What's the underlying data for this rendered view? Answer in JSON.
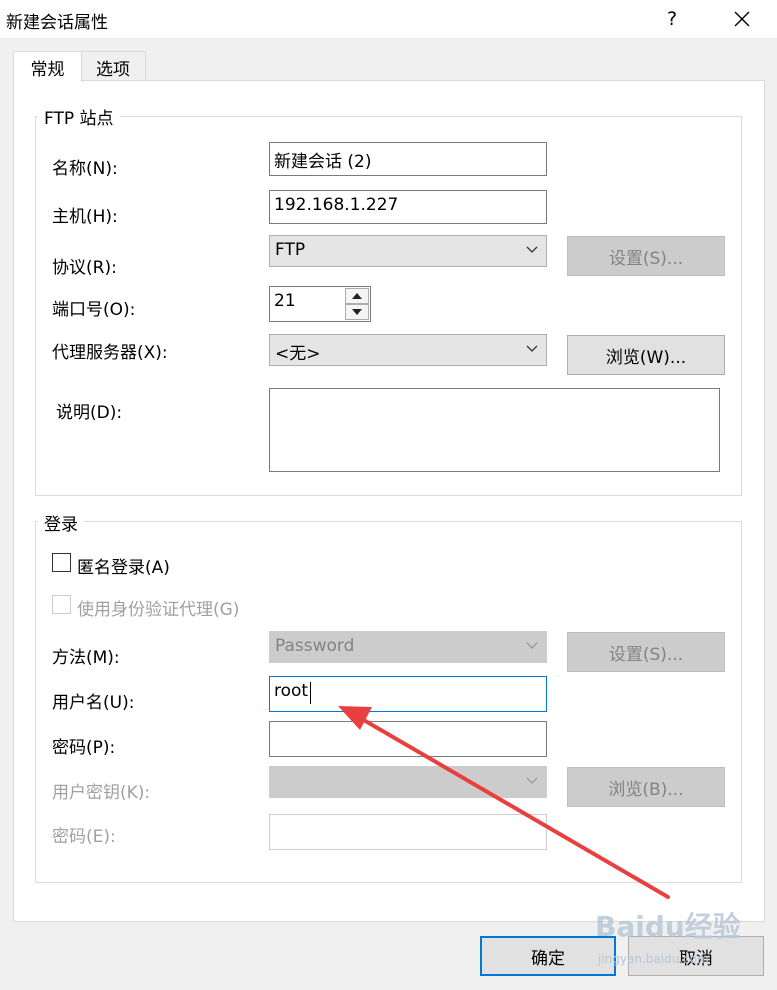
{
  "window": {
    "title": "新建会话属性",
    "help": "?",
    "close_icon": "close-icon"
  },
  "tabs": [
    {
      "label": "常规",
      "active": true
    },
    {
      "label": "选项",
      "active": false
    }
  ],
  "ftp_site": {
    "title": "FTP 站点",
    "name_label": "名称(N):",
    "name_value": "新建会话 (2)",
    "host_label": "主机(H):",
    "host_value": "192.168.1.227",
    "protocol_label": "协议(R):",
    "protocol_value": "FTP",
    "protocol_settings": "设置(S)...",
    "port_label": "端口号(O):",
    "port_value": "21",
    "proxy_label": "代理服务器(X):",
    "proxy_value": "<无>",
    "proxy_browse": "浏览(W)...",
    "desc_label": "说明(D):",
    "desc_value": ""
  },
  "login": {
    "title": "登录",
    "anonymous_label": "匿名登录(A)",
    "agent_label": "使用身份验证代理(G)",
    "method_label": "方法(M):",
    "method_value": "Password",
    "method_settings": "设置(S)...",
    "username_label": "用户名(U):",
    "username_value": "root",
    "password_label": "密码(P):",
    "password_value": "",
    "userkey_label": "用户密钥(K):",
    "userkey_browse": "浏览(B)...",
    "passphrase_label": "密码(E):"
  },
  "footer": {
    "ok": "确定",
    "cancel": "取消"
  },
  "annotation": {
    "arrow_color": "#e8403f"
  },
  "watermark": {
    "brand": "Baidu经验",
    "sub": "jingyan.baidu.com"
  }
}
